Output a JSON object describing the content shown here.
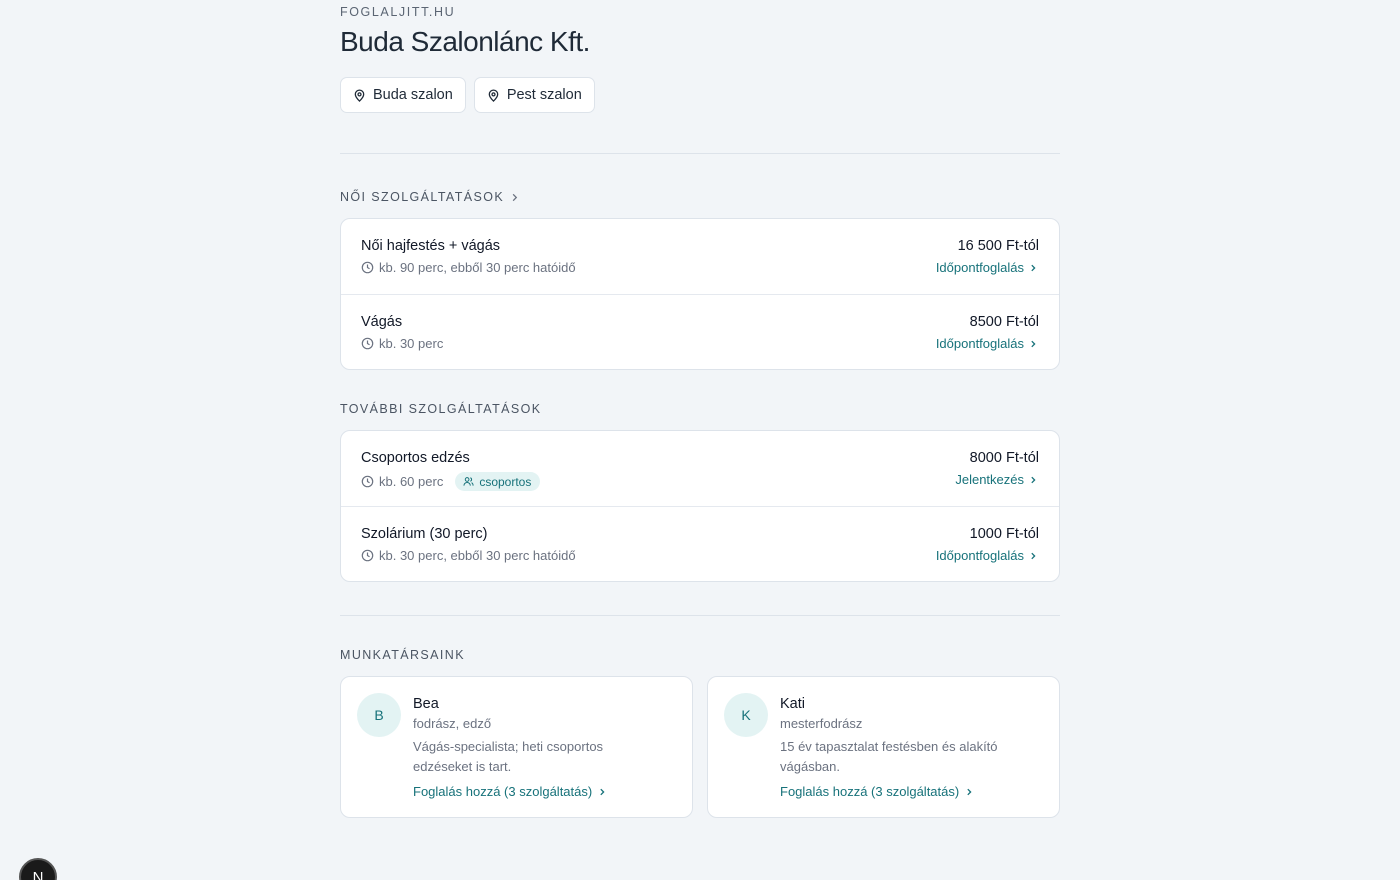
{
  "header": {
    "site": "FOGLALJITT.HU",
    "title": "Buda Szalonlánc Kft.",
    "locations": [
      {
        "label": "Buda szalon"
      },
      {
        "label": "Pest szalon"
      }
    ]
  },
  "sections": [
    {
      "title": "NŐI SZOLGÁLTATÁSOK",
      "services": [
        {
          "name": "Női hajfestés + vágás",
          "meta": "kb. 90 perc, ebből 30 perc hatóidő",
          "price": "16 500 Ft-tól",
          "action": "Időpontfoglalás"
        },
        {
          "name": "Vágás",
          "meta": "kb. 30 perc",
          "price": "8500 Ft-tól",
          "action": "Időpontfoglalás"
        }
      ]
    },
    {
      "title": "TOVÁBBI SZOLGÁLTATÁSOK",
      "services": [
        {
          "name": "Csoportos edzés",
          "meta": "kb. 60 perc",
          "badge": "csoportos",
          "price": "8000 Ft-tól",
          "action": "Jelentkezés"
        },
        {
          "name": "Szolárium (30 perc)",
          "meta": "kb. 30 perc, ebből 30 perc hatóidő",
          "price": "1000 Ft-tól",
          "action": "Időpontfoglalás"
        }
      ]
    }
  ],
  "staff": {
    "title": "MUNKATÁRSAINK",
    "members": [
      {
        "initial": "B",
        "name": "Bea",
        "role": "fodrász, edző",
        "description": "Vágás-specialista; heti csoportos edzéseket is tart.",
        "link": "Foglalás hozzá (3 szolgáltatás)"
      },
      {
        "initial": "K",
        "name": "Kati",
        "role": "mesterfodrász",
        "description": "15 év tapasztalat festésben és alakító vágásban.",
        "link": "Foglalás hozzá (3 szolgáltatás)"
      }
    ]
  },
  "dev_badge": "N",
  "colors": {
    "accent": "#17727a",
    "background": "#f2f5f8",
    "badge_bg": "#e3f3f3"
  }
}
